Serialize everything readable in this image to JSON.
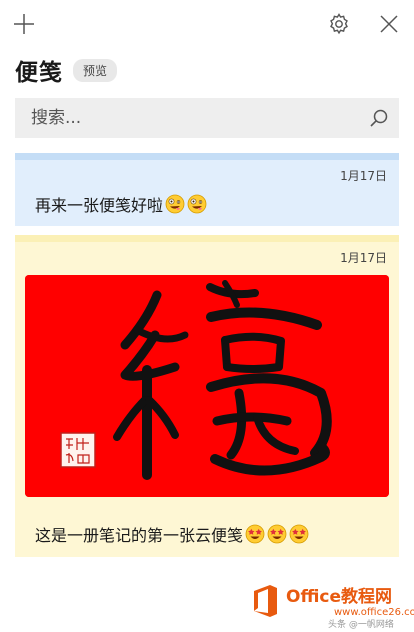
{
  "toolbar": {
    "icons": [
      "add-icon",
      "gear-icon",
      "close-icon"
    ]
  },
  "header": {
    "title": "便笺",
    "badge": "预览"
  },
  "search": {
    "placeholder": "搜索..."
  },
  "notes": [
    {
      "date": "1月17日",
      "text": "再来一张便笺好啦",
      "color": "#e1eefc",
      "accent": "#c4ddf6",
      "emojis": [
        "zany-face",
        "zany-face"
      ]
    },
    {
      "date": "1月17日",
      "text": "这是一册笔记的第一张云便笺",
      "color": "#fef7d4",
      "accent": "#fbf0b6",
      "image": "fu-calligraphy-red",
      "image_seal": "seal-stamp",
      "emojis": [
        "star-struck",
        "star-struck",
        "star-struck"
      ]
    }
  ],
  "watermark": {
    "title": "Office教程网",
    "url": "www.office26.com",
    "author": "头条 @一帆网络"
  }
}
